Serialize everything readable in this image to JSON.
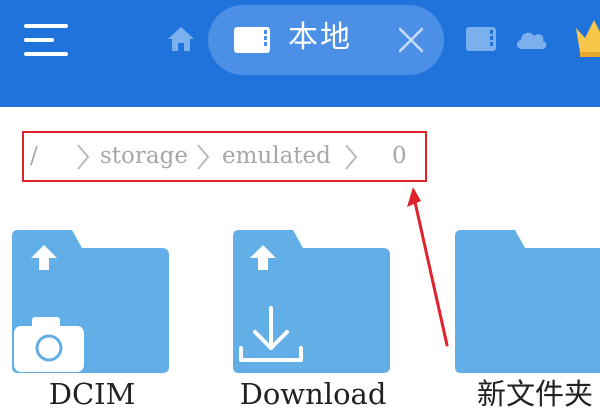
{
  "header": {
    "menu_icon": "hamburger-menu-icon",
    "home_icon": "home-icon",
    "active_tab": {
      "label": "本地",
      "icon": "sd-card-icon",
      "close_icon": "close-icon"
    },
    "other_tabs": [
      {
        "icon": "sd-card-icon"
      },
      {
        "icon": "cloud-icon"
      }
    ],
    "vip_icon": "crown-icon",
    "colors": {
      "bar": "#2173dc",
      "active_tab": "#4c8fe6",
      "crown": "#f7c64a"
    }
  },
  "breadcrumb": {
    "items": [
      "/",
      "storage",
      "emulated",
      "0"
    ],
    "highlight_color": "#e0232b"
  },
  "folders": [
    {
      "name": "DCIM",
      "badge_icon": "camera-icon"
    },
    {
      "name": "Download",
      "badge_icon": "download-icon"
    },
    {
      "name": "新文件夹",
      "badge_icon": ""
    }
  ],
  "folder_color": "#62aee6"
}
